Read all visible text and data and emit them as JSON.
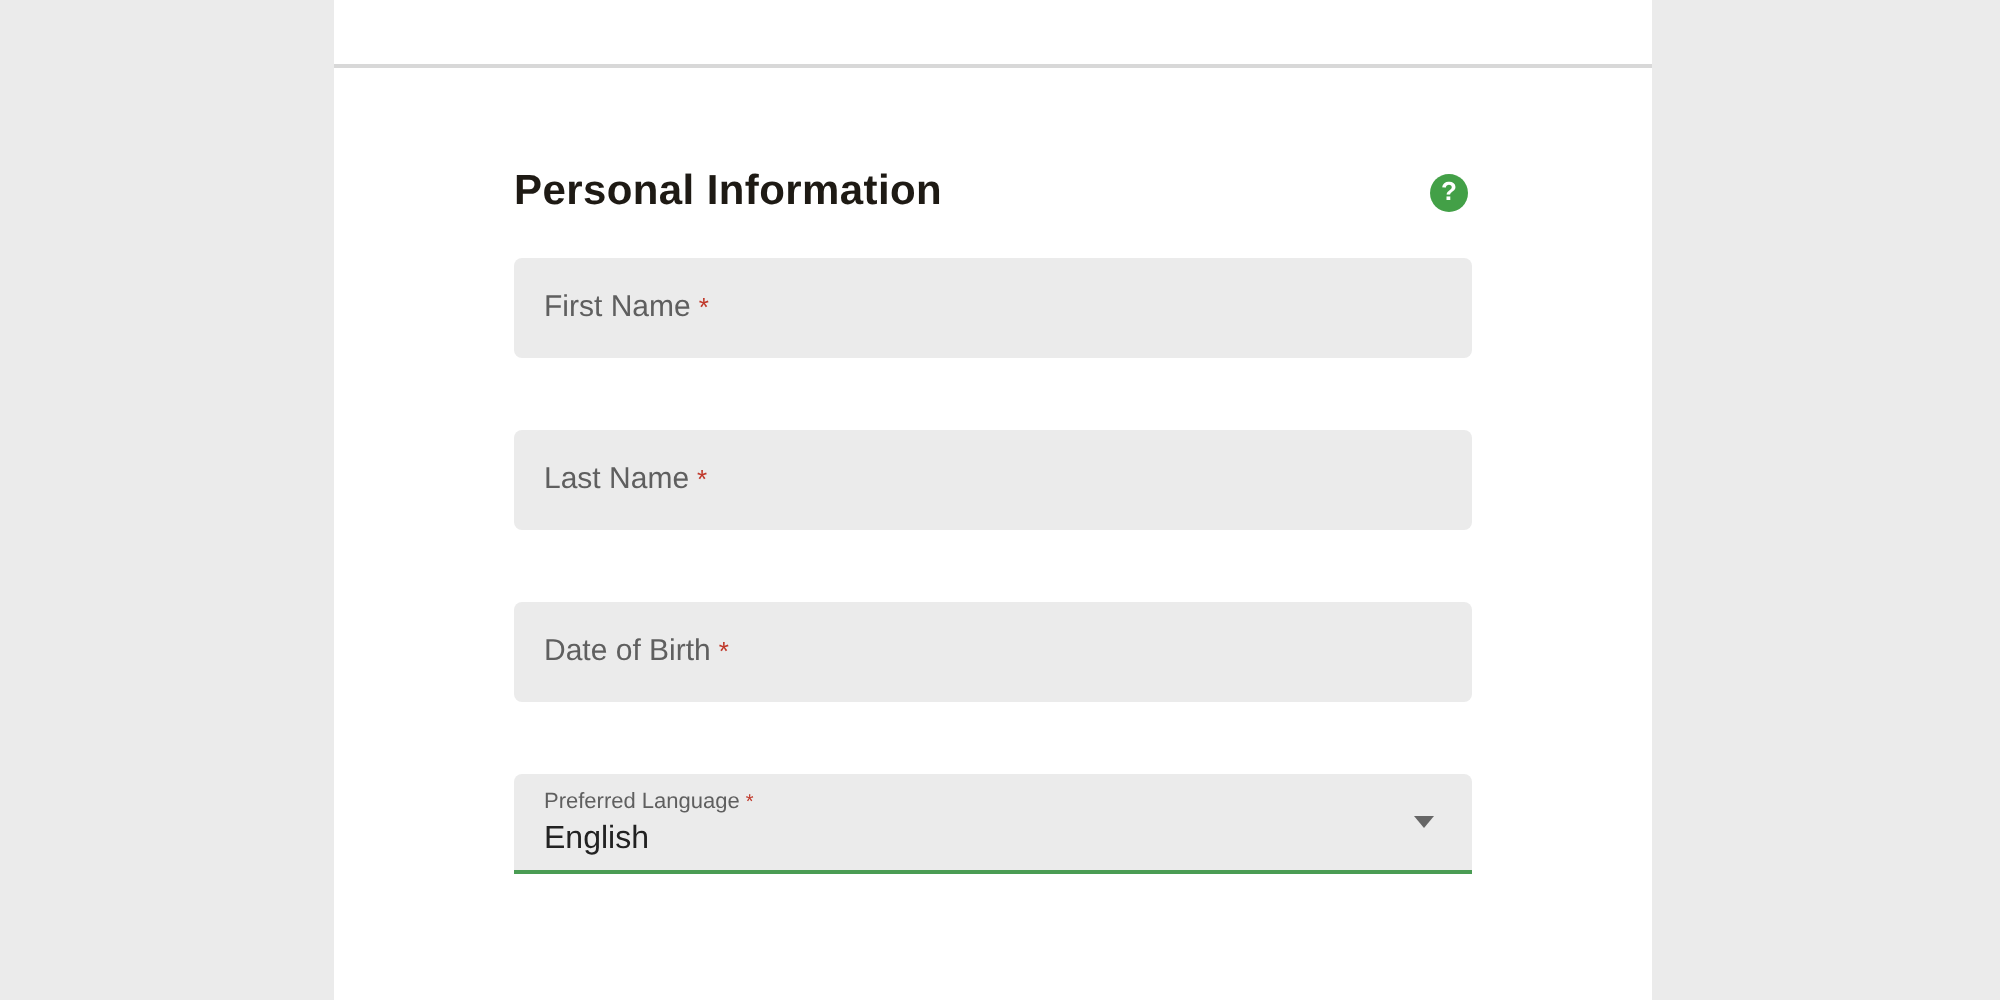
{
  "section": {
    "title": "Personal Information",
    "help_icon": "?"
  },
  "fields": [
    {
      "kind": "text",
      "label": "First Name",
      "required_mark": "*",
      "focused": false
    },
    {
      "kind": "text",
      "label": "Last Name",
      "required_mark": "*",
      "focused": false
    },
    {
      "kind": "text",
      "label": "Date of Birth",
      "required_mark": "*",
      "focused": false
    },
    {
      "kind": "select",
      "label": "Preferred Language",
      "required_mark": "*",
      "value": "English",
      "focused": true
    }
  ]
}
